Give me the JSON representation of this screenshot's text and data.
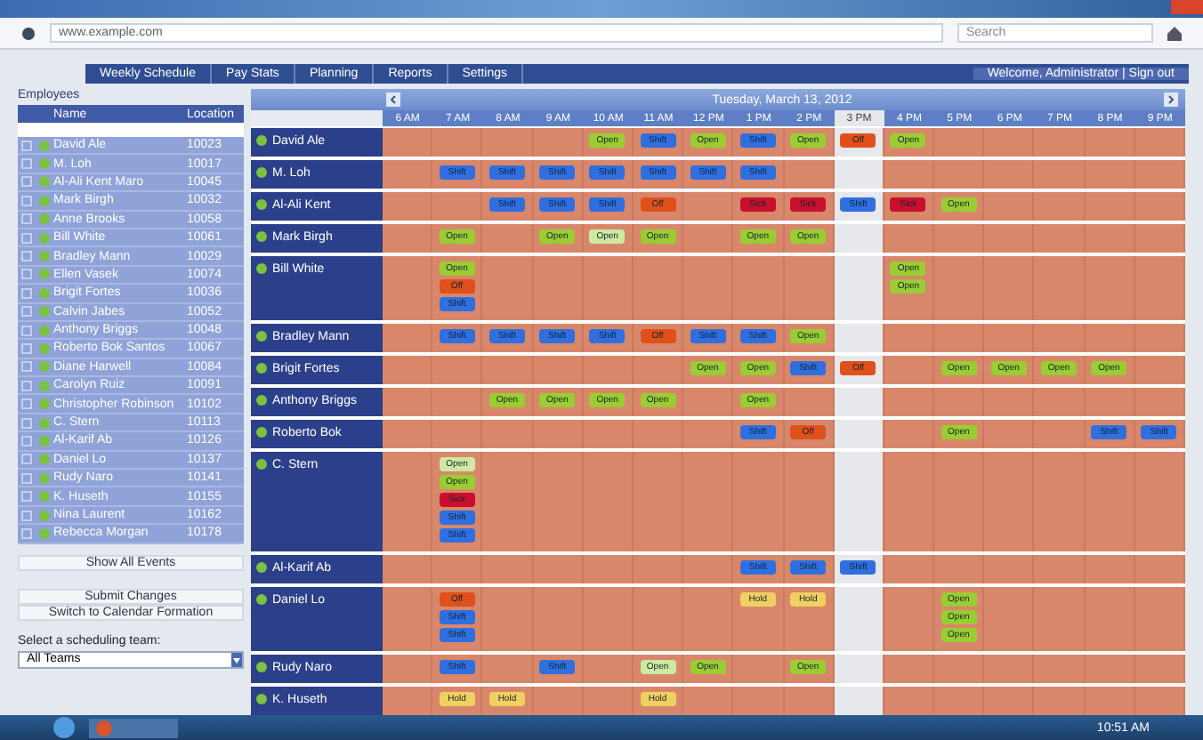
{
  "browser": {
    "address": "www.example.com",
    "search": "Search"
  },
  "nav": {
    "tabs": [
      {
        "label": "Weekly Schedule",
        "selected": false
      },
      {
        "label": "Pay Stats",
        "selected": false
      },
      {
        "label": "Planning",
        "selected": false
      },
      {
        "label": "Reports",
        "selected": false
      },
      {
        "label": "Settings",
        "selected": false
      }
    ],
    "welcome": "Welcome, Administrator | Sign out"
  },
  "employees": {
    "title": "Employees",
    "columns": [
      "Name",
      "Location"
    ],
    "rows": [
      {
        "name": "David Ale",
        "code": "10023",
        "checked": false
      },
      {
        "name": "M. Loh",
        "code": "10017",
        "checked": false
      },
      {
        "name": "Al-Ali Kent Maro",
        "code": "10045",
        "checked": false
      },
      {
        "name": "Mark Birgh",
        "code": "10032",
        "checked": false
      },
      {
        "name": "Anne Brooks",
        "code": "10058",
        "checked": false
      },
      {
        "name": "Bill White",
        "code": "10061",
        "checked": false
      },
      {
        "name": "Bradley Mann",
        "code": "10029",
        "checked": false
      },
      {
        "name": "Ellen Vasek",
        "code": "10074",
        "checked": false
      },
      {
        "name": "Brigit Fortes",
        "code": "10036",
        "checked": false
      },
      {
        "name": "Calvin Jabes",
        "code": "10052",
        "checked": false
      },
      {
        "name": "Anthony Briggs",
        "code": "10048",
        "checked": false
      },
      {
        "name": "Roberto Bok Santos",
        "code": "10067",
        "checked": false
      },
      {
        "name": "Diane Harwell",
        "code": "10084",
        "checked": false
      },
      {
        "name": "Carolyn Ruiz",
        "code": "10091",
        "checked": false
      },
      {
        "name": "Christopher Robinson",
        "code": "10102",
        "checked": false
      },
      {
        "name": "C. Stern",
        "code": "10113",
        "checked": false
      },
      {
        "name": "Al-Karif Ab",
        "code": "10126",
        "checked": false
      },
      {
        "name": "Daniel Lo",
        "code": "10137",
        "checked": false
      },
      {
        "name": "Rudy Naro",
        "code": "10141",
        "checked": false
      },
      {
        "name": "K. Huseth",
        "code": "10155",
        "checked": false
      },
      {
        "name": "Nina Laurent",
        "code": "10162",
        "checked": false
      },
      {
        "name": "Rebecca Morgan",
        "code": "10178",
        "checked": false
      }
    ],
    "buttons": [
      "Show All Events",
      "Submit Changes",
      "Switch to Calendar Formation"
    ],
    "team_label": "Select a scheduling team:",
    "team_value": "All Teams"
  },
  "schedule": {
    "date": "Tuesday, March 13, 2012",
    "times": [
      {
        "label": "6 AM",
        "selected": false
      },
      {
        "label": "7 AM",
        "selected": false
      },
      {
        "label": "8 AM",
        "selected": false
      },
      {
        "label": "9 AM",
        "selected": false
      },
      {
        "label": "10 AM",
        "selected": false
      },
      {
        "label": "11 AM",
        "selected": false
      },
      {
        "label": "12 PM",
        "selected": false
      },
      {
        "label": "1 PM",
        "selected": false
      },
      {
        "label": "2 PM",
        "selected": false
      },
      {
        "label": "3 PM",
        "selected": true
      },
      {
        "label": "4 PM",
        "selected": false
      },
      {
        "label": "5 PM",
        "selected": false
      },
      {
        "label": "6 PM",
        "selected": false
      },
      {
        "label": "7 PM",
        "selected": false
      },
      {
        "label": "8 PM",
        "selected": false
      },
      {
        "label": "9 PM",
        "selected": false
      }
    ],
    "rows": [
      {
        "name": "David Ale",
        "cells": [
          [],
          [],
          [],
          [],
          [
            {
              "label": "Open",
              "color": "#9acd32"
            }
          ],
          [
            {
              "label": "Shift",
              "color": "#2f6fe0"
            }
          ],
          [
            {
              "label": "Open",
              "color": "#9acd32"
            }
          ],
          [
            {
              "label": "Shift",
              "color": "#2f6fe0"
            }
          ],
          [
            {
              "label": "Open",
              "color": "#9acd32"
            }
          ],
          [
            {
              "label": "Off",
              "color": "#e0501a"
            }
          ],
          [
            {
              "label": "Open",
              "color": "#9acd32"
            }
          ],
          [],
          [],
          [],
          [],
          []
        ]
      },
      {
        "name": "M. Loh",
        "cells": [
          [],
          [
            {
              "label": "Shift",
              "color": "#2f6fe0"
            }
          ],
          [
            {
              "label": "Shift",
              "color": "#2f6fe0"
            }
          ],
          [
            {
              "label": "Shift",
              "color": "#2f6fe0"
            }
          ],
          [
            {
              "label": "Shift",
              "color": "#2f6fe0"
            }
          ],
          [
            {
              "label": "Shift",
              "color": "#2f6fe0"
            }
          ],
          [
            {
              "label": "Shift",
              "color": "#2f6fe0"
            }
          ],
          [
            {
              "label": "Shift",
              "color": "#2f6fe0"
            }
          ],
          [],
          [],
          [],
          [],
          [],
          [],
          [],
          []
        ]
      },
      {
        "name": "Al-Ali Kent",
        "cells": [
          [],
          [],
          [
            {
              "label": "Shift",
              "color": "#2f6fe0"
            }
          ],
          [
            {
              "label": "Shift",
              "color": "#2f6fe0"
            }
          ],
          [
            {
              "label": "Shift",
              "color": "#2f6fe0"
            }
          ],
          [
            {
              "label": "Off",
              "color": "#e0501a"
            }
          ],
          [],
          [
            {
              "label": "Sick",
              "color": "#c8102e"
            }
          ],
          [
            {
              "label": "Sick",
              "color": "#c8102e"
            }
          ],
          [
            {
              "label": "Shift",
              "color": "#2f6fe0"
            }
          ],
          [
            {
              "label": "Sick",
              "color": "#c8102e"
            }
          ],
          [
            {
              "label": "Open",
              "color": "#9acd32"
            }
          ],
          [],
          [],
          [],
          []
        ]
      },
      {
        "name": "Mark Birgh",
        "cells": [
          [],
          [
            {
              "label": "Open",
              "color": "#9acd32"
            }
          ],
          [],
          [
            {
              "label": "Open",
              "color": "#9acd32"
            }
          ],
          [
            {
              "label": "Open",
              "color": "#cdeaa0"
            }
          ],
          [
            {
              "label": "Open",
              "color": "#9acd32"
            }
          ],
          [],
          [
            {
              "label": "Open",
              "color": "#9acd32"
            }
          ],
          [
            {
              "label": "Open",
              "color": "#9acd32"
            }
          ],
          [],
          [],
          [],
          [],
          [],
          [],
          []
        ]
      },
      {
        "name": "Bill White",
        "cells": [
          [],
          [
            {
              "label": "Open",
              "color": "#9acd32"
            },
            {
              "label": "Off",
              "color": "#e0501a"
            },
            {
              "label": "Shift",
              "color": "#2f6fe0"
            }
          ],
          [],
          [],
          [],
          [],
          [],
          [],
          [],
          [],
          [
            {
              "label": "Open",
              "color": "#9acd32"
            },
            {
              "label": "Open",
              "color": "#9acd32"
            }
          ],
          [],
          [],
          [],
          [],
          []
        ]
      },
      {
        "name": "Bradley Mann",
        "cells": [
          [],
          [
            {
              "label": "Shift",
              "color": "#2f6fe0"
            }
          ],
          [
            {
              "label": "Shift",
              "color": "#2f6fe0"
            }
          ],
          [
            {
              "label": "Shift",
              "color": "#2f6fe0"
            }
          ],
          [
            {
              "label": "Shift",
              "color": "#2f6fe0"
            }
          ],
          [
            {
              "label": "Off",
              "color": "#e0501a"
            }
          ],
          [
            {
              "label": "Shift",
              "color": "#2f6fe0"
            }
          ],
          [
            {
              "label": "Shift",
              "color": "#2f6fe0"
            }
          ],
          [
            {
              "label": "Open",
              "color": "#9acd32"
            }
          ],
          [],
          [],
          [],
          [],
          [],
          [],
          []
        ]
      },
      {
        "name": "Brigit Fortes",
        "cells": [
          [],
          [],
          [],
          [],
          [],
          [],
          [
            {
              "label": "Open",
              "color": "#9acd32"
            }
          ],
          [
            {
              "label": "Open",
              "color": "#9acd32"
            }
          ],
          [
            {
              "label": "Shift",
              "color": "#2f6fe0"
            }
          ],
          [
            {
              "label": "Off",
              "color": "#e0501a"
            }
          ],
          [],
          [
            {
              "label": "Open",
              "color": "#9acd32"
            }
          ],
          [
            {
              "label": "Open",
              "color": "#9acd32"
            }
          ],
          [
            {
              "label": "Open",
              "color": "#9acd32"
            }
          ],
          [
            {
              "label": "Open",
              "color": "#9acd32"
            }
          ],
          []
        ]
      },
      {
        "name": "Anthony Briggs",
        "cells": [
          [],
          [],
          [
            {
              "label": "Open",
              "color": "#9acd32"
            }
          ],
          [
            {
              "label": "Open",
              "color": "#9acd32"
            }
          ],
          [
            {
              "label": "Open",
              "color": "#9acd32"
            }
          ],
          [
            {
              "label": "Open",
              "color": "#9acd32"
            }
          ],
          [],
          [
            {
              "label": "Open",
              "color": "#9acd32"
            }
          ],
          [],
          [],
          [],
          [],
          [],
          [],
          [],
          []
        ]
      },
      {
        "name": "Roberto Bok",
        "cells": [
          [],
          [],
          [],
          [],
          [],
          [],
          [],
          [
            {
              "label": "Shift",
              "color": "#2f6fe0"
            }
          ],
          [
            {
              "label": "Off",
              "color": "#e0501a"
            }
          ],
          [],
          [],
          [
            {
              "label": "Open",
              "color": "#9acd32"
            }
          ],
          [],
          [],
          [
            {
              "label": "Shift",
              "color": "#2f6fe0"
            }
          ],
          [
            {
              "label": "Shift",
              "color": "#2f6fe0"
            }
          ]
        ]
      },
      {
        "name": "C. Stern",
        "cells": [
          [],
          [
            {
              "label": "Open",
              "color": "#cdeaa0"
            },
            {
              "label": "Open",
              "color": "#9acd32"
            },
            {
              "label": "Sick",
              "color": "#c8102e"
            },
            {
              "label": "Shift",
              "color": "#2f6fe0"
            },
            {
              "label": "Shift",
              "color": "#2f6fe0"
            }
          ],
          [],
          [],
          [],
          [],
          [],
          [],
          [],
          [],
          [],
          [],
          [],
          [],
          [],
          []
        ]
      },
      {
        "name": "Al-Karif Ab",
        "cells": [
          [],
          [],
          [],
          [],
          [],
          [],
          [],
          [
            {
              "label": "Shift",
              "color": "#2f6fe0"
            }
          ],
          [
            {
              "label": "Shift",
              "color": "#2f6fe0"
            }
          ],
          [
            {
              "label": "Shift",
              "color": "#2f6fe0"
            }
          ],
          [],
          [],
          [],
          [],
          [],
          []
        ]
      },
      {
        "name": "Daniel Lo",
        "cells": [
          [],
          [
            {
              "label": "Off",
              "color": "#e0501a"
            },
            {
              "label": "Shift",
              "color": "#2f6fe0"
            },
            {
              "label": "Shift",
              "color": "#2f6fe0"
            }
          ],
          [],
          [],
          [],
          [],
          [],
          [
            {
              "label": "Hold",
              "color": "#f0d060"
            }
          ],
          [
            {
              "label": "Hold",
              "color": "#f0d060"
            }
          ],
          [],
          [],
          [
            {
              "label": "Open",
              "color": "#9acd32"
            },
            {
              "label": "Open",
              "color": "#9acd32"
            },
            {
              "label": "Open",
              "color": "#9acd32"
            }
          ],
          [],
          [],
          [],
          []
        ]
      },
      {
        "name": "Rudy Naro",
        "cells": [
          [],
          [
            {
              "label": "Shift",
              "color": "#2f6fe0"
            }
          ],
          [],
          [
            {
              "label": "Shift",
              "color": "#2f6fe0"
            }
          ],
          [],
          [
            {
              "label": "Open",
              "color": "#cdeaa0"
            }
          ],
          [
            {
              "label": "Open",
              "color": "#9acd32"
            }
          ],
          [],
          [
            {
              "label": "Open",
              "color": "#9acd32"
            }
          ],
          [],
          [],
          [],
          [],
          [],
          [],
          []
        ]
      },
      {
        "name": "K. Huseth",
        "cells": [
          [],
          [
            {
              "label": "Hold",
              "color": "#f0d060"
            }
          ],
          [
            {
              "label": "Hold",
              "color": "#f0d060"
            }
          ],
          [],
          [],
          [
            {
              "label": "Hold",
              "color": "#f0d060"
            }
          ],
          [],
          [],
          [],
          [],
          [],
          [],
          [],
          [],
          [],
          []
        ]
      }
    ]
  },
  "taskbar": {
    "clock": "10:51 AM"
  }
}
